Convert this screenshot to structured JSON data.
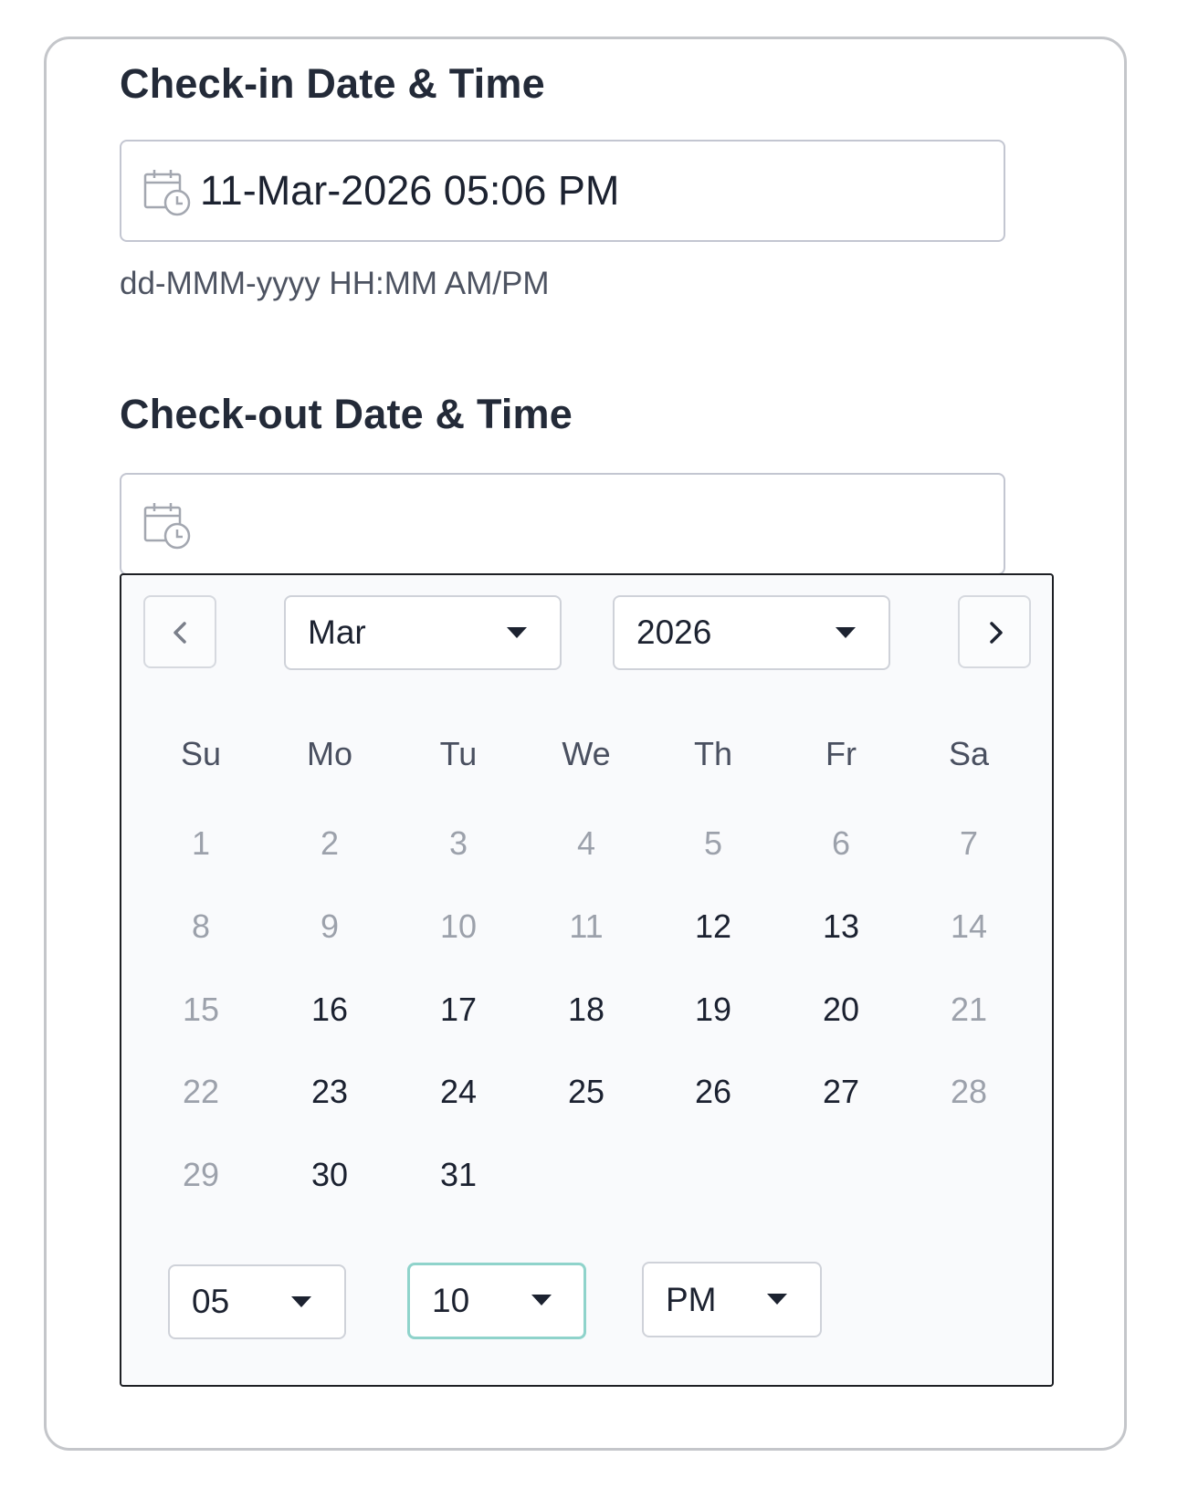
{
  "checkin": {
    "label": "Check-in Date & Time",
    "value": "11-Mar-2026 05:06 PM",
    "hint": "dd-MMM-yyyy HH:MM AM/PM",
    "icon": "calendar-clock-icon"
  },
  "checkout": {
    "label": "Check-out Date & Time",
    "value": "",
    "icon": "calendar-clock-icon"
  },
  "picker": {
    "prev_icon": "chevron-left-icon",
    "next_icon": "chevron-right-icon",
    "month": "Mar",
    "year": "2026",
    "weekdays": [
      "Su",
      "Mo",
      "Tu",
      "We",
      "Th",
      "Fr",
      "Sa"
    ],
    "days": [
      {
        "label": "1",
        "enabled": false
      },
      {
        "label": "2",
        "enabled": false
      },
      {
        "label": "3",
        "enabled": false
      },
      {
        "label": "4",
        "enabled": false
      },
      {
        "label": "5",
        "enabled": false
      },
      {
        "label": "6",
        "enabled": false
      },
      {
        "label": "7",
        "enabled": false
      },
      {
        "label": "8",
        "enabled": false
      },
      {
        "label": "9",
        "enabled": false
      },
      {
        "label": "10",
        "enabled": false
      },
      {
        "label": "11",
        "enabled": false
      },
      {
        "label": "12",
        "enabled": true
      },
      {
        "label": "13",
        "enabled": true
      },
      {
        "label": "14",
        "enabled": false
      },
      {
        "label": "15",
        "enabled": false
      },
      {
        "label": "16",
        "enabled": true
      },
      {
        "label": "17",
        "enabled": true
      },
      {
        "label": "18",
        "enabled": true
      },
      {
        "label": "19",
        "enabled": true
      },
      {
        "label": "20",
        "enabled": true
      },
      {
        "label": "21",
        "enabled": false
      },
      {
        "label": "22",
        "enabled": false
      },
      {
        "label": "23",
        "enabled": true
      },
      {
        "label": "24",
        "enabled": true
      },
      {
        "label": "25",
        "enabled": true
      },
      {
        "label": "26",
        "enabled": true
      },
      {
        "label": "27",
        "enabled": true
      },
      {
        "label": "28",
        "enabled": false
      },
      {
        "label": "29",
        "enabled": false
      },
      {
        "label": "30",
        "enabled": true
      },
      {
        "label": "31",
        "enabled": true
      }
    ],
    "hour": "05",
    "minute": "10",
    "ampm": "PM",
    "focused_color": "#8fd3cb",
    "enabled_day_color": "#1b2130",
    "disabled_day_color": "#9ca1ab"
  }
}
